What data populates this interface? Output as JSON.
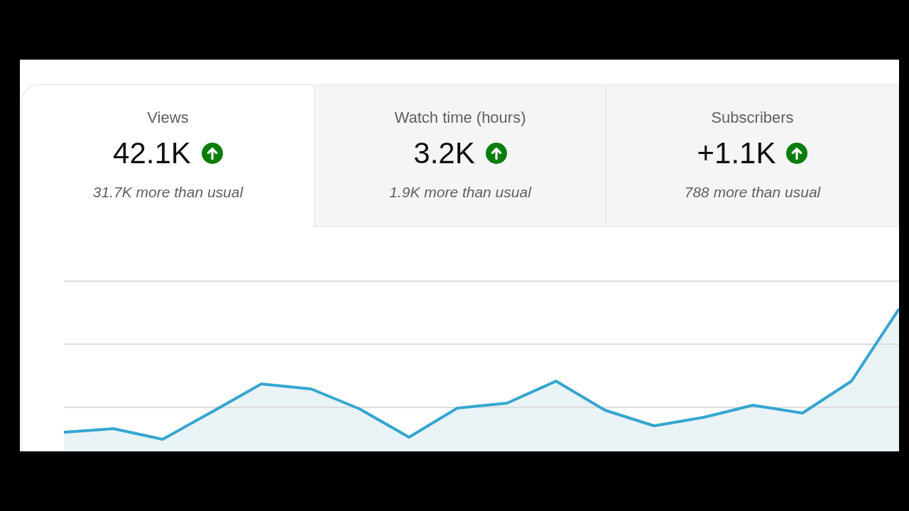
{
  "metric_tabs": [
    {
      "label": "Views",
      "value": "42.1K",
      "rising": true,
      "comparison": "31.7K more than usual",
      "selected": true
    },
    {
      "label": "Watch time (hours)",
      "value": "3.2K",
      "rising": true,
      "comparison": "1.9K more than usual",
      "selected": false
    },
    {
      "label": "Subscribers",
      "value": "+1.1K",
      "rising": true,
      "comparison": "788 more than usual",
      "selected": false
    }
  ]
}
